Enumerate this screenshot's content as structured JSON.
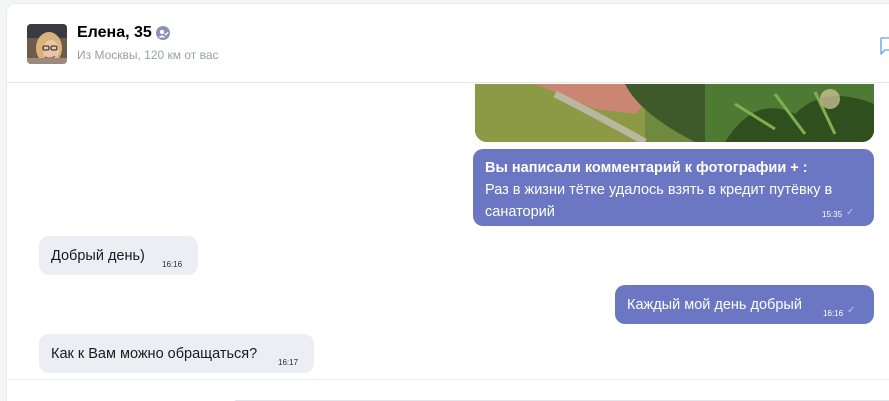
{
  "contact": {
    "name": "Елена, 35",
    "subtitle": "Из Москвы, 120 км от вас"
  },
  "icons": {
    "verified": "verified-badge-icon",
    "chat": "chat-bubble-icon",
    "read": "read-check-icon"
  },
  "messages": [
    {
      "direction": "out",
      "title": "Вы написали комментарий к фотографии + :",
      "text": "Раз в жизни тётке удалось взять в кредит путёвку в санаторий",
      "time": "15:35",
      "read": true
    },
    {
      "direction": "in",
      "text": "Добрый день)",
      "time": "16:16"
    },
    {
      "direction": "out",
      "text": "Каждый мой день добрый",
      "time": "16:16",
      "read": true
    },
    {
      "direction": "in",
      "text": "Как к Вам можно обращаться?",
      "time": "16:17"
    }
  ],
  "colors": {
    "outgoing_bubble": "#6b77c3",
    "incoming_bubble": "#eceef4",
    "read_check": "#a9c8ff"
  }
}
